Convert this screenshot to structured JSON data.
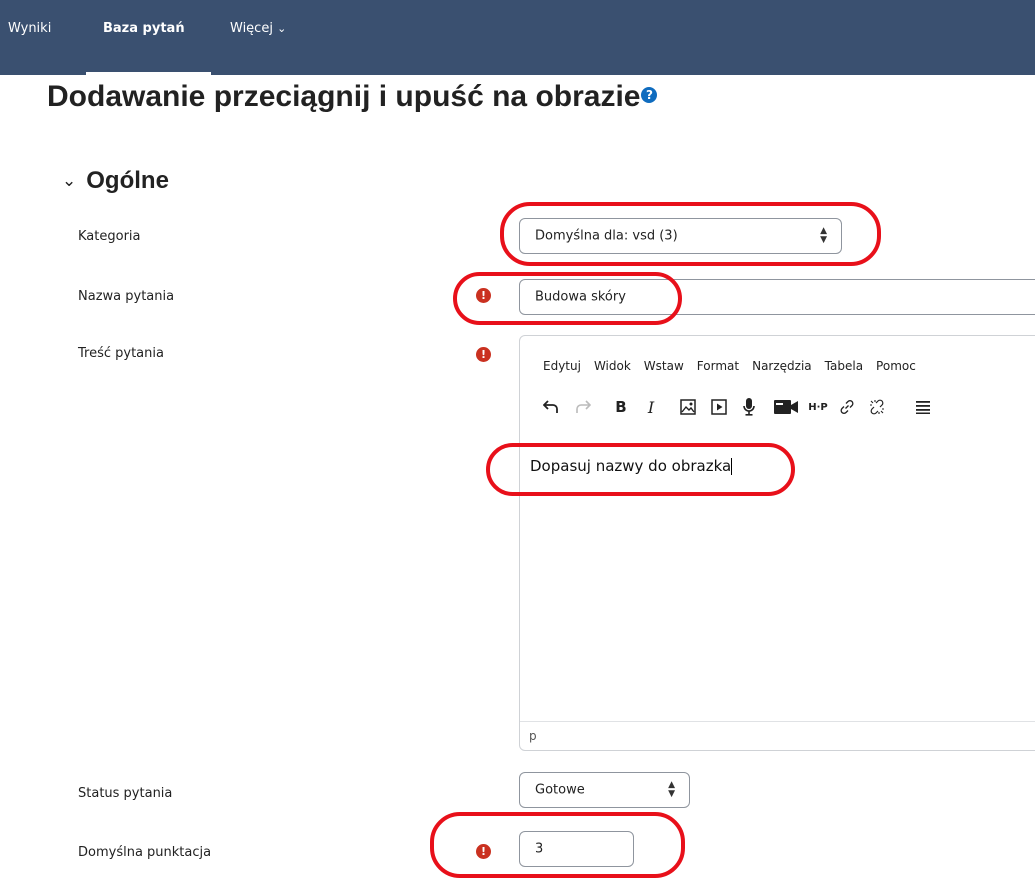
{
  "nav": {
    "items": [
      {
        "label": "Wyniki"
      },
      {
        "label": "Baza pytań"
      },
      {
        "label": "Więcej"
      }
    ],
    "more_chevron": "⌄"
  },
  "page": {
    "title": "Dodawanie przeciągnij i upuść na obrazie",
    "help_icon": "?"
  },
  "section": {
    "chevron": "⌄",
    "title": "Ogólne"
  },
  "form": {
    "category": {
      "label": "Kategoria",
      "value": "Domyślna dla: vsd (3)"
    },
    "question_name": {
      "label": "Nazwa pytania",
      "value": "Budowa skóry"
    },
    "question_text": {
      "label": "Treść pytania",
      "menu": [
        "Edytuj",
        "Widok",
        "Wstaw",
        "Format",
        "Narzędzia",
        "Tabela",
        "Pomoc"
      ],
      "content": "Dopasuj nazwy do obrazka",
      "status_path": "p"
    },
    "status": {
      "label": "Status pytania",
      "value": "Gotowe"
    },
    "default_mark": {
      "label": "Domyślna punktacja",
      "value": "3"
    }
  },
  "icons": {
    "required": "!",
    "select_arrow": "▲▼"
  },
  "colors": {
    "navbar": "#3a5070",
    "required": "#ca3120",
    "annotation": "#e8101a",
    "help": "#0f6cbf"
  }
}
